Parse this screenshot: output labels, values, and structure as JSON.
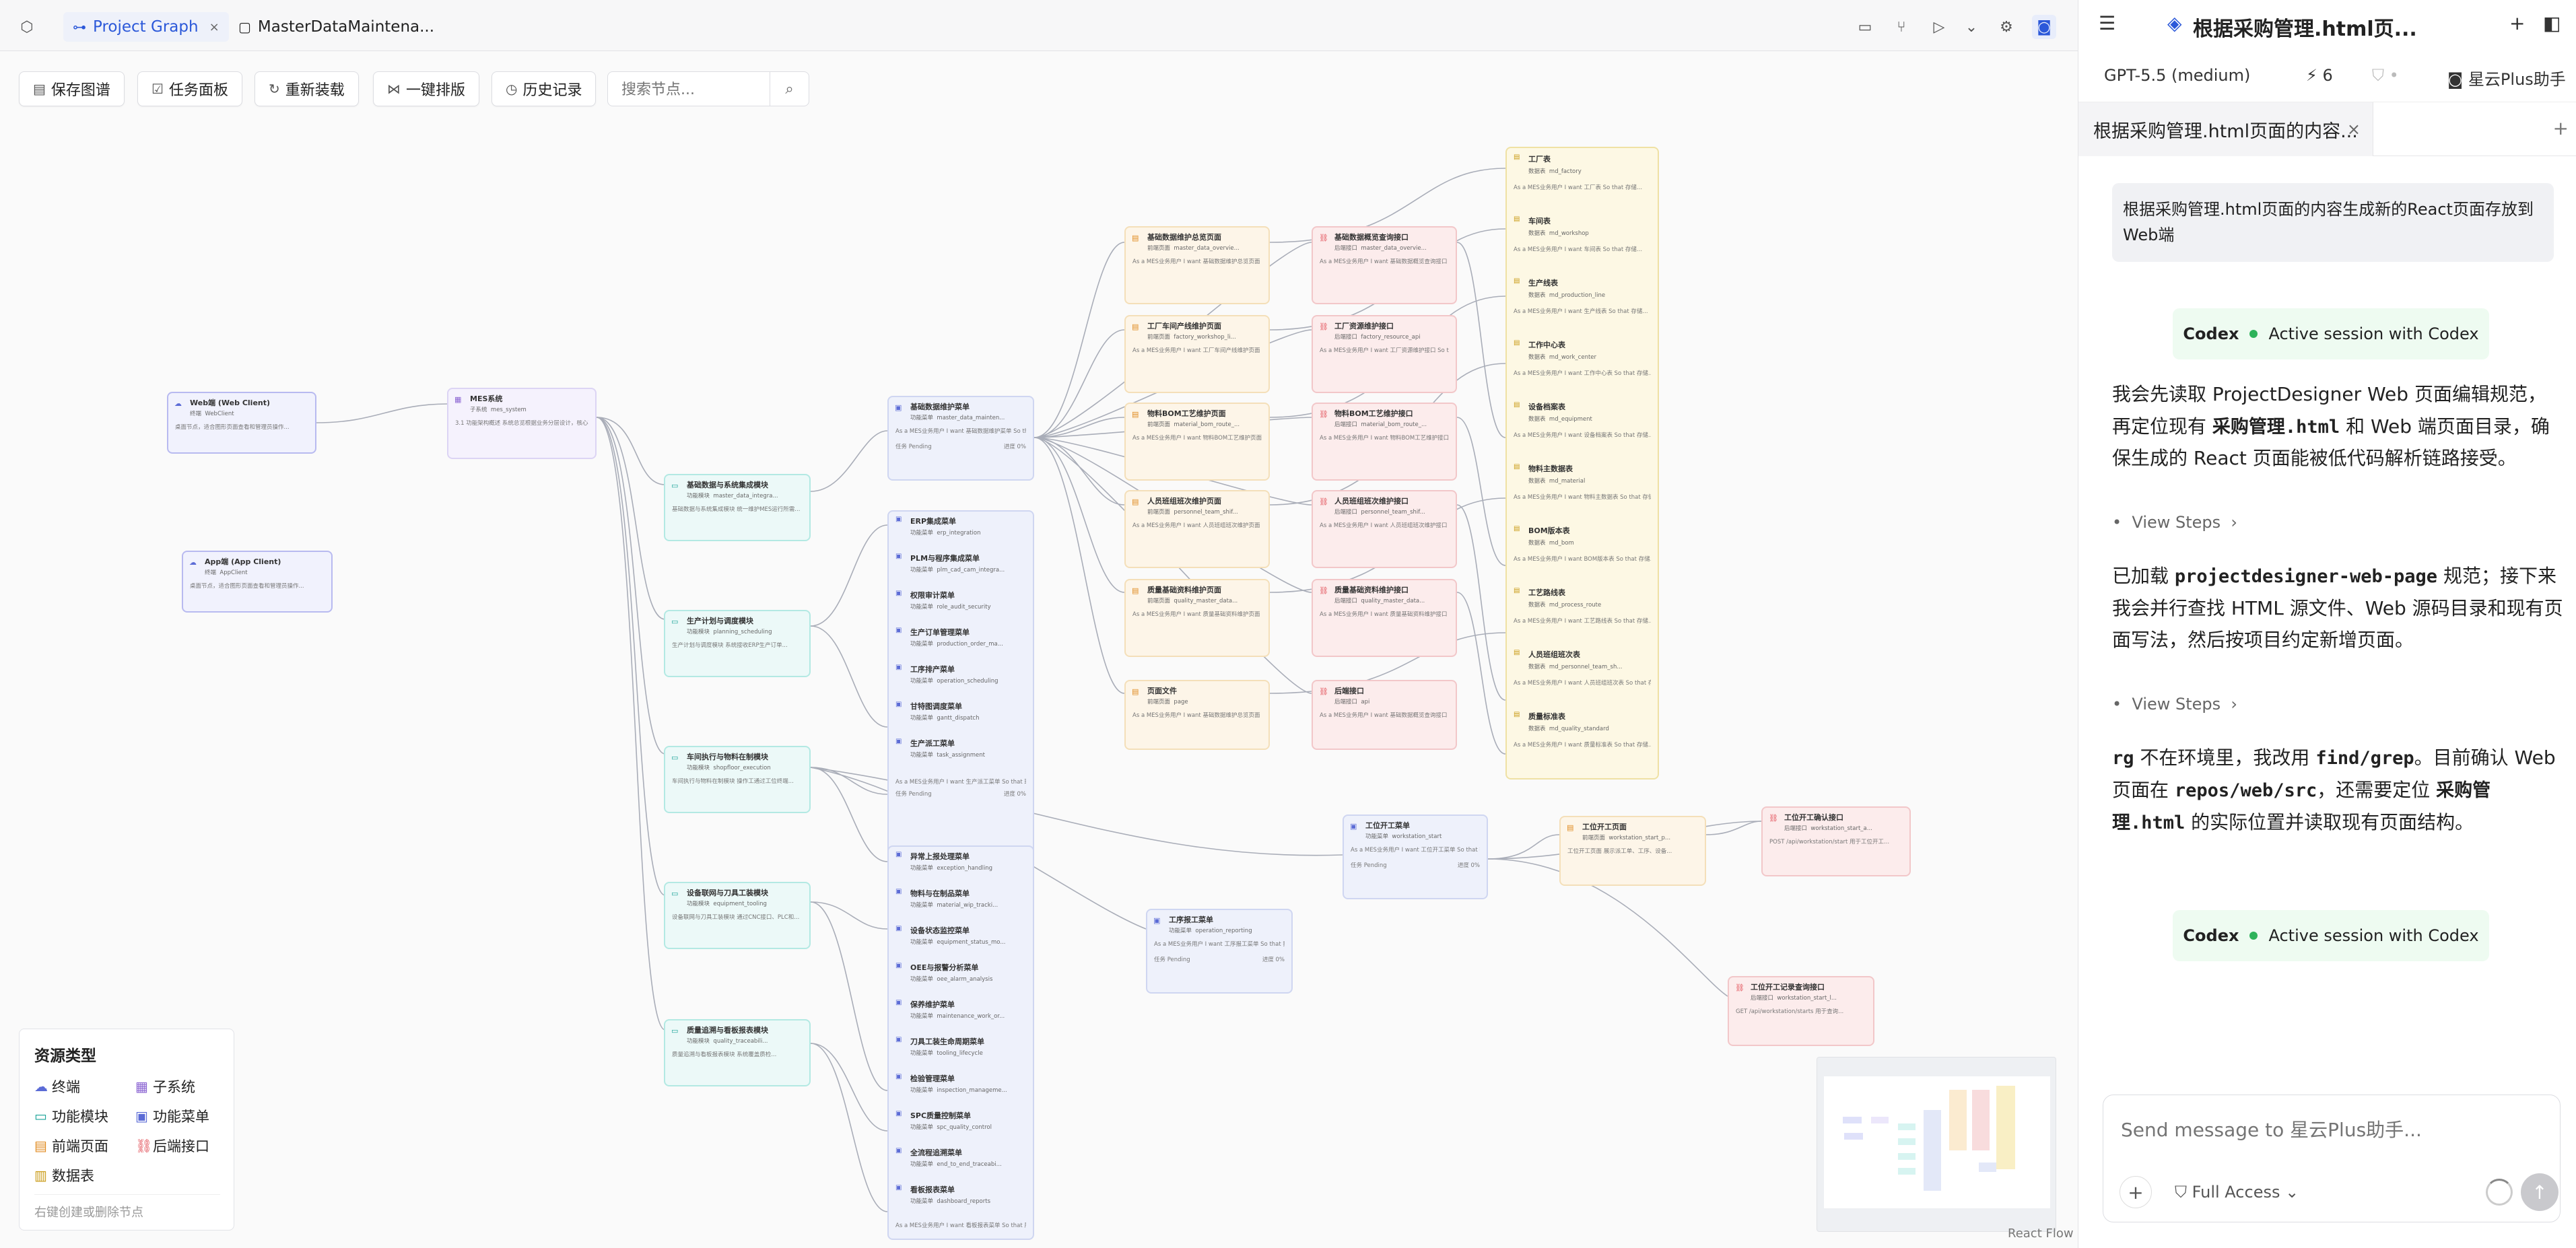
{
  "tabs": [
    {
      "label": "Project Graph"
    },
    {
      "label": "MasterDataMaintena..."
    }
  ],
  "toolbar": {
    "save": "保存图谱",
    "tasks": "任务面板",
    "reload": "重新装载",
    "layout": "一键排版",
    "history": "历史记录",
    "search_placeholder": "搜索节点..."
  },
  "clients": [
    {
      "title": "Web端 (Web Client)",
      "tag": "终端",
      "code": "WebClient",
      "desc": "桌面节点，适合图形页面查看和管理员操作..."
    },
    {
      "title": "App端 (App Client)",
      "tag": "终端",
      "code": "AppClient",
      "desc": "桌面节点，适合图形页面查看和管理员操作..."
    }
  ],
  "system": {
    "title": "MES系统",
    "tag": "子系统",
    "code": "mes_system",
    "desc": "3.1 功能架构概述 系统总览根据业务分层设计，核心功能..."
  },
  "modules": [
    {
      "title": "基础数据与系统集成模块",
      "tag": "功能模块",
      "code": "master_data_integra...",
      "desc": "基础数据与系统集成模块 统一维护MES运行所需..."
    },
    {
      "title": "生产计划与调度模块",
      "tag": "功能模块",
      "code": "planning_scheduling",
      "desc": "生产计划与调度模块 系统接收ERP生产订单..."
    },
    {
      "title": "车间执行与物料在制模块",
      "tag": "功能模块",
      "code": "shopfloor_execution",
      "desc": "车间执行与物料在制模块 操作工通过工位终端..."
    },
    {
      "title": "设备联网与刀具工装模块",
      "tag": "功能模块",
      "code": "equipment_tooling",
      "desc": "设备联网与刀具工装模块 通过CNC接口、PLC和..."
    },
    {
      "title": "质量追溯与看板报表模块",
      "tag": "功能模块",
      "code": "quality_traceabili...",
      "desc": "质量追溯与看板报表模块 系统覆盖质检..."
    }
  ],
  "menu_main": {
    "title": "基础数据维护菜单",
    "tag": "功能菜单",
    "code": "master_data_mainten...",
    "desc": "As a MES业务用户 I want 基础数据维护菜单 So that 维护工厂、车间...",
    "status": "任务 Pending",
    "progress": "进度 0%"
  },
  "menu_group_a": [
    {
      "title": "ERP集成菜单",
      "code": "erp_integration"
    },
    {
      "title": "PLM与程序集成菜单",
      "code": "plm_cad_cam_integra..."
    },
    {
      "title": "权限审计菜单",
      "code": "role_audit_security"
    },
    {
      "title": "生产订单管理菜单",
      "code": "production_order_ma..."
    },
    {
      "title": "工序排产菜单",
      "code": "operation_scheduling"
    },
    {
      "title": "甘特图调度菜单",
      "code": "gantt_dispatch"
    },
    {
      "title": "生产派工菜单",
      "code": "task_assignment"
    }
  ],
  "menu_group_a_footer": {
    "desc": "As a MES业务用户 I want 生产派工菜单 So that 班组长...",
    "status": "任务 Pending",
    "progress": "进度 0%"
  },
  "menu_group_b": [
    {
      "title": "异常上报处理菜单",
      "code": "exception_handling"
    },
    {
      "title": "物料与在制品菜单",
      "code": "material_wip_tracki..."
    },
    {
      "title": "设备状态监控菜单",
      "code": "equipment_status_mo..."
    },
    {
      "title": "OEE与报警分析菜单",
      "code": "oee_alarm_analysis"
    },
    {
      "title": "保养维护菜单",
      "code": "maintenance_work_or..."
    },
    {
      "title": "刀具工装生命周期菜单",
      "code": "tooling_lifecycle"
    },
    {
      "title": "检验管理菜单",
      "code": "inspection_manageme..."
    },
    {
      "title": "SPC质量控制菜单",
      "code": "spc_quality_control"
    },
    {
      "title": "全流程追溯菜单",
      "code": "end_to_end_traceabi..."
    },
    {
      "title": "看板报表菜单",
      "code": "dashboard_reports"
    }
  ],
  "menu_group_b_footer": {
    "desc": "As a MES业务用户 I want 看板报表菜单 So that 展示计划达成率、OEE、产量..."
  },
  "pages": [
    {
      "title": "基础数据维护总览页面",
      "tag": "前端页面",
      "code": "master_data_overvie...",
      "desc": "As a MES业务用户 I want 基础数据维护总览页面 So that 汇总展示..."
    },
    {
      "title": "工厂车间产线维护页面",
      "tag": "前端页面",
      "code": "factory_workshop_li...",
      "desc": "As a MES业务用户 I want 工厂车间产线维护页面 So that 维护..."
    },
    {
      "title": "物料BOM工艺维护页面",
      "tag": "前端页面",
      "code": "material_bom_route_...",
      "desc": "As a MES业务用户 I want 物料BOM工艺维护页面 So that 维护..."
    },
    {
      "title": "人员班组班次维护页面",
      "tag": "前端页面",
      "code": "personnel_team_shif...",
      "desc": "As a MES业务用户 I want 人员班组班次维护页面 So that 维护..."
    },
    {
      "title": "质量基础资料维护页面",
      "tag": "前端页面",
      "code": "quality_master_data...",
      "desc": "As a MES业务用户 I want 质量基础资料维护页面 So that 维护..."
    },
    {
      "title": "页面文件",
      "tag": "前端页面",
      "code": "page",
      "desc": "As a MES业务用户 I want 基础数据维护总览页面 So that 在..."
    }
  ],
  "apis": [
    {
      "title": "基础数据概览查询接口",
      "tag": "后端接口",
      "code": "master_data_overvie...",
      "desc": "As a MES业务用户 I want 基础数据概览查询接口 So that 提供..."
    },
    {
      "title": "工厂资源维护接口",
      "tag": "后端接口",
      "code": "factory_resource_api",
      "desc": "As a MES业务用户 I want 工厂资源维护接口 So that 维护..."
    },
    {
      "title": "物料BOM工艺维护接口",
      "tag": "后端接口",
      "code": "material_bom_route_...",
      "desc": "As a MES业务用户 I want 物料BOM工艺维护接口 So that 维护..."
    },
    {
      "title": "人员班组班次维护接口",
      "tag": "后端接口",
      "code": "personnel_team_shif...",
      "desc": "As a MES业务用户 I want 人员班组班次维护接口 So that 维护..."
    },
    {
      "title": "质量基础资料维护接口",
      "tag": "后端接口",
      "code": "quality_master_data...",
      "desc": "As a MES业务用户 I want 质量基础资料维护接口 So that 维护..."
    },
    {
      "title": "后端接口",
      "tag": "后端接口",
      "code": "api",
      "desc": "As a MES业务用户 I want 基础数据概览查询接口 So that 在..."
    }
  ],
  "tables": [
    {
      "title": "工厂表",
      "tag": "数据表",
      "code": "md_factory",
      "desc": "As a MES业务用户 I want 工厂表 So that 存储..."
    },
    {
      "title": "车间表",
      "tag": "数据表",
      "code": "md_workshop",
      "desc": "As a MES业务用户 I want 车间表 So that 存储..."
    },
    {
      "title": "生产线表",
      "tag": "数据表",
      "code": "md_production_line",
      "desc": "As a MES业务用户 I want 生产线表 So that 存储..."
    },
    {
      "title": "工作中心表",
      "tag": "数据表",
      "code": "md_work_center",
      "desc": "As a MES业务用户 I want 工作中心表 So that 存储..."
    },
    {
      "title": "设备档案表",
      "tag": "数据表",
      "code": "md_equipment",
      "desc": "As a MES业务用户 I want 设备档案表 So that 存储..."
    },
    {
      "title": "物料主数据表",
      "tag": "数据表",
      "code": "md_material",
      "desc": "As a MES业务用户 I want 物料主数据表 So that 存储..."
    },
    {
      "title": "BOM版本表",
      "tag": "数据表",
      "code": "md_bom",
      "desc": "As a MES业务用户 I want BOM版本表 So that 存储..."
    },
    {
      "title": "工艺路线表",
      "tag": "数据表",
      "code": "md_process_route",
      "desc": "As a MES业务用户 I want 工艺路线表 So that 存储..."
    },
    {
      "title": "人员班组班次表",
      "tag": "数据表",
      "code": "md_personnel_team_sh...",
      "desc": "As a MES业务用户 I want 人员班组班次表 So that 存储..."
    },
    {
      "title": "质量标准表",
      "tag": "数据表",
      "code": "md_quality_standard",
      "desc": "As a MES业务用户 I want 质量标准表 So that 存储..."
    }
  ],
  "ws_menu": {
    "title": "工位开工菜单",
    "tag": "功能菜单",
    "code": "workstation_start",
    "desc": "As a MES业务用户 I want 工位开工菜单 So that 操作工扫码...",
    "status": "任务 Pending",
    "progress": "进度 0%"
  },
  "ws_page": {
    "title": "工位开工页面",
    "tag": "前端页面",
    "code": "workstation_start_p...",
    "desc": "工位开工页面 展示派工单、工序、设备..."
  },
  "ws_api": {
    "title": "工位开工确认接口",
    "tag": "后端接口",
    "code": "workstation_start_a...",
    "desc": "POST /api/workstation/start 用于工位开工..."
  },
  "ws_api2": {
    "title": "工位开工记录查询接口",
    "tag": "后端接口",
    "code": "workstation_start_l...",
    "desc": "GET /api/workstation/starts 用于查询..."
  },
  "report_menu": {
    "title": "工序报工菜单",
    "tag": "功能菜单",
    "code": "operation_reporting",
    "desc": "As a MES业务用户 I want 工序报工菜单 So that 操作工完成...",
    "status": "任务 Pending",
    "progress": "进度 0%"
  },
  "legend": {
    "title": "资源类型",
    "items": [
      "终端",
      "子系统",
      "功能模块",
      "功能菜单",
      "前端页面",
      "后端接口",
      "数据表"
    ],
    "hint": "右键创建或删除节点"
  },
  "reactflow_label": "React Flow",
  "panel": {
    "title": "根据采购管理.html页...",
    "model": "GPT-5.5 (medium)",
    "count": "6",
    "assistant": "星云Plus助手",
    "tab": "根据采购管理.html页面的内容...",
    "user_msg": "根据采购管理.html页面的内容生成新的React页面存放到Web端",
    "codex_label": "Codex",
    "codex_status": "Active session with Codex",
    "p1_a": "我会先读取 ProjectDesigner Web 页面编辑规范，再定位现有 ",
    "p1_code1": "采购管理.html",
    "p1_b": " 和 Web 端页面目录，确保生成的 React 页面能被低代码解析链路接受。",
    "view_steps": "View Steps",
    "p2_a": "已加载 ",
    "p2_code": "projectdesigner-web-page",
    "p2_b": " 规范；接下来我会并行查找 HTML 源文件、Web 源码目录和现有页面写法，然后按项目约定新增页面。",
    "p3_code1": "rg",
    "p3_a": " 不在环境里，我改用 ",
    "p3_code2": "find/grep",
    "p3_b": "。目前确认 Web 页面在 ",
    "p3_code3": "repos/web/src",
    "p3_c": "，还需要定位 ",
    "p3_code4": "采购管理.html",
    "p3_d": " 的实际位置并读取现有页面结构。",
    "composer_placeholder": "Send message to 星云Plus助手...",
    "access": "Full Access"
  }
}
